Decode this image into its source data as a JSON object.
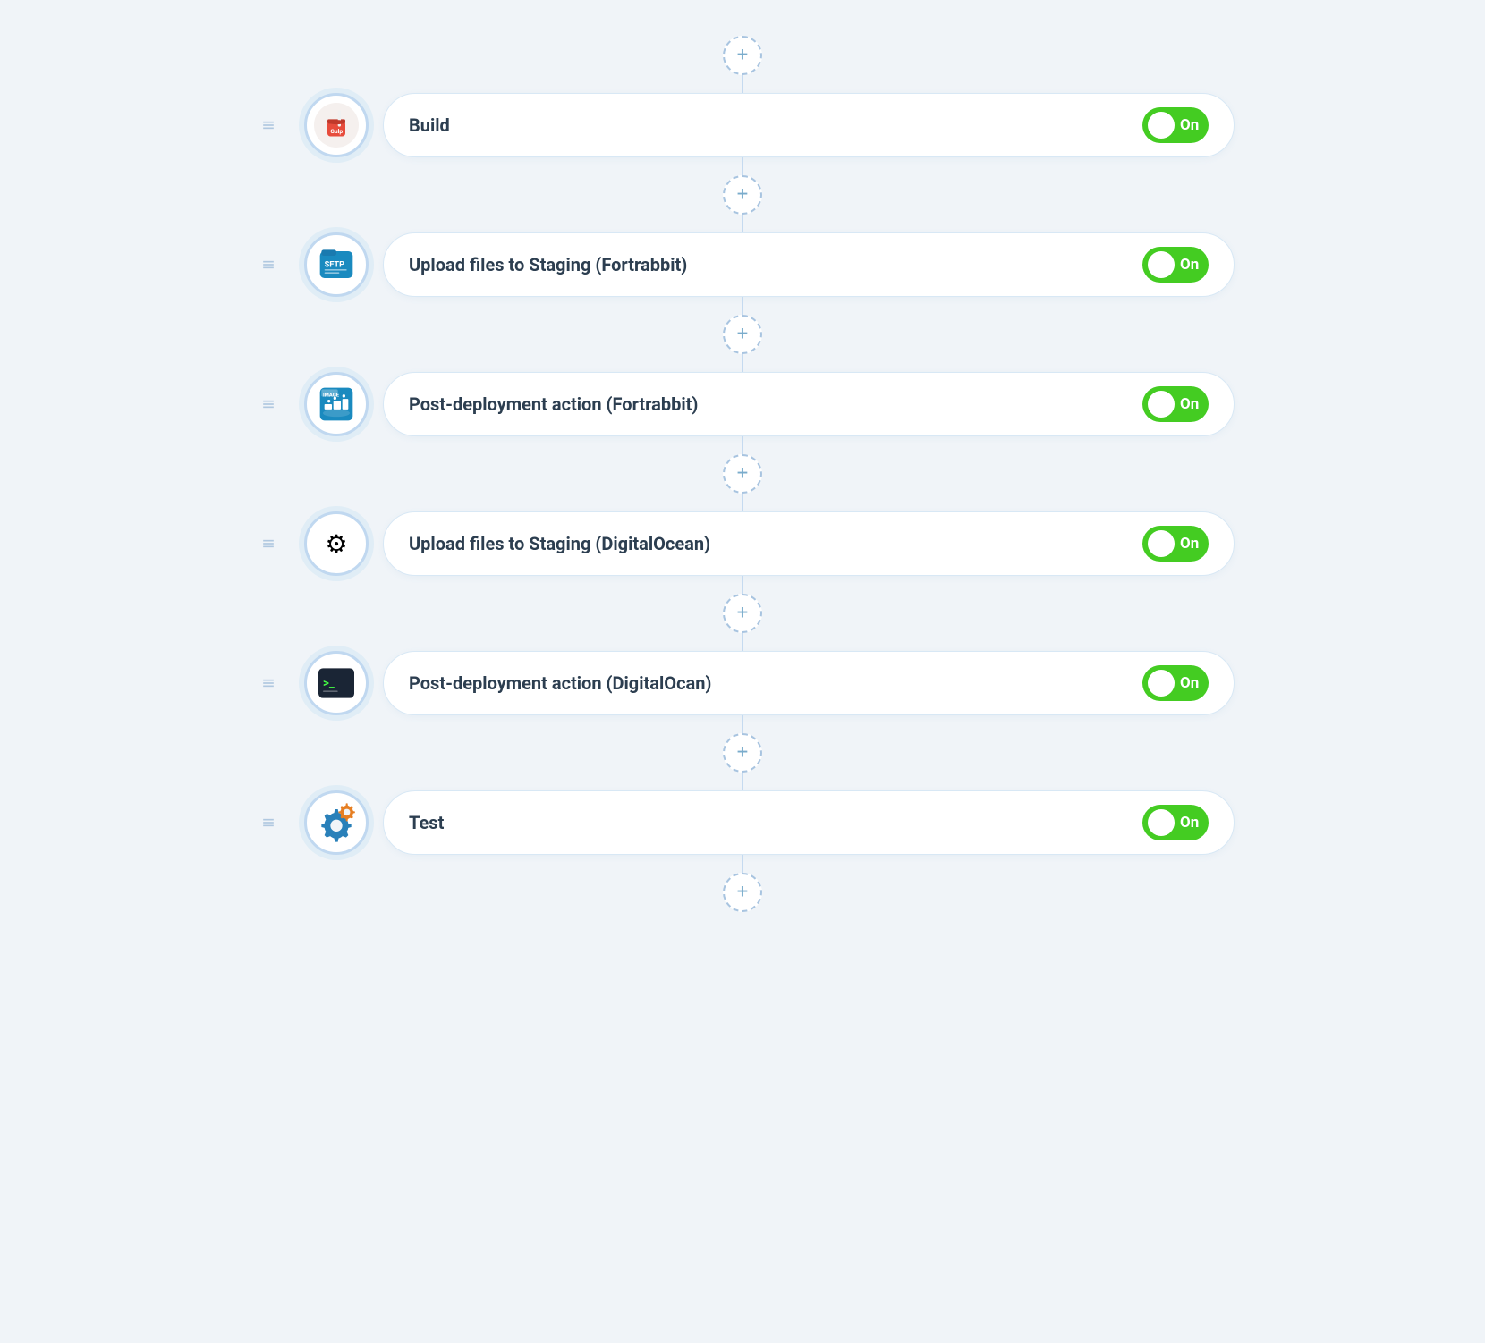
{
  "pipeline": {
    "steps": [
      {
        "id": "build",
        "label": "Build",
        "icon_type": "gulp",
        "icon_symbol": "gulp",
        "toggle_state": "On",
        "toggle_color": "#44cc22"
      },
      {
        "id": "upload-staging-fortrabbit",
        "label": "Upload files to Staging (Fortrabbit)",
        "icon_type": "sftp",
        "icon_symbol": "sftp",
        "toggle_state": "On",
        "toggle_color": "#44cc22"
      },
      {
        "id": "post-deploy-fortrabbit",
        "label": "Post-deployment action  (Fortrabbit)",
        "icon_type": "docker",
        "icon_symbol": "docker",
        "toggle_state": "On",
        "toggle_color": "#44cc22"
      },
      {
        "id": "upload-staging-digitalocean",
        "label": "Upload files to Staging (DigitalOcean)",
        "icon_type": "digitalocean",
        "icon_symbol": "do",
        "toggle_state": "On",
        "toggle_color": "#44cc22"
      },
      {
        "id": "post-deploy-digitalocean",
        "label": "Post-deployment action  (DigitalOcan)",
        "icon_type": "terminal",
        "icon_symbol": "terminal",
        "toggle_state": "On",
        "toggle_color": "#44cc22"
      },
      {
        "id": "test",
        "label": "Test",
        "icon_type": "settings",
        "icon_symbol": "settings",
        "toggle_state": "On",
        "toggle_color": "#44cc22"
      }
    ],
    "add_button_title": "Add step"
  }
}
